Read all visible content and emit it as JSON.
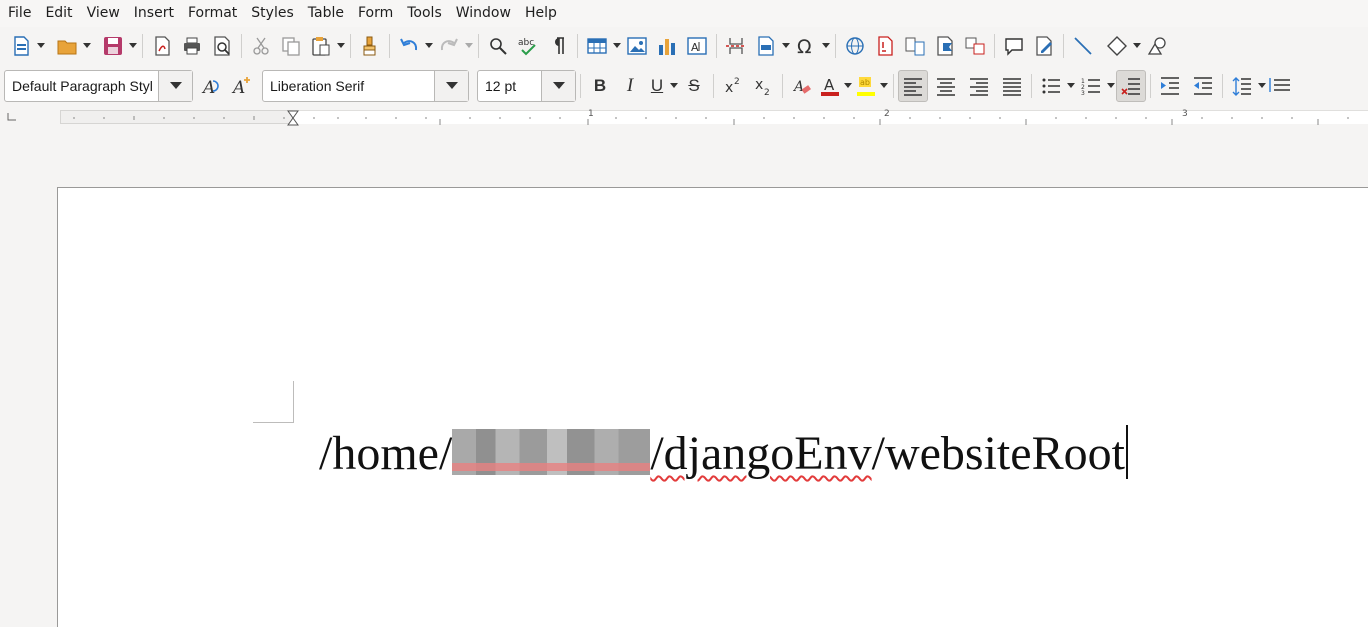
{
  "menubar": {
    "items": [
      {
        "label": "File"
      },
      {
        "label": "Edit"
      },
      {
        "label": "View"
      },
      {
        "label": "Insert"
      },
      {
        "label": "Format"
      },
      {
        "label": "Styles"
      },
      {
        "label": "Table"
      },
      {
        "label": "Form"
      },
      {
        "label": "Tools"
      },
      {
        "label": "Window"
      },
      {
        "label": "Help"
      }
    ]
  },
  "formatting": {
    "paragraph_style": "Default Paragraph Styl",
    "font_name": "Liberation Serif",
    "font_size": "12 pt",
    "bold_label": "B",
    "italic_label": "I",
    "underline_label": "U",
    "strike_label": "S"
  },
  "ruler": {
    "numbers": [
      "1",
      "2",
      "3"
    ]
  },
  "document": {
    "text_before": "/home/",
    "text_middle": "/djangoEnv",
    "text_after": "/websiteRoot"
  },
  "colors": {
    "font_color": "#c9211e",
    "highlight_color": "#ffff00",
    "accent": "#2f7ed8"
  }
}
